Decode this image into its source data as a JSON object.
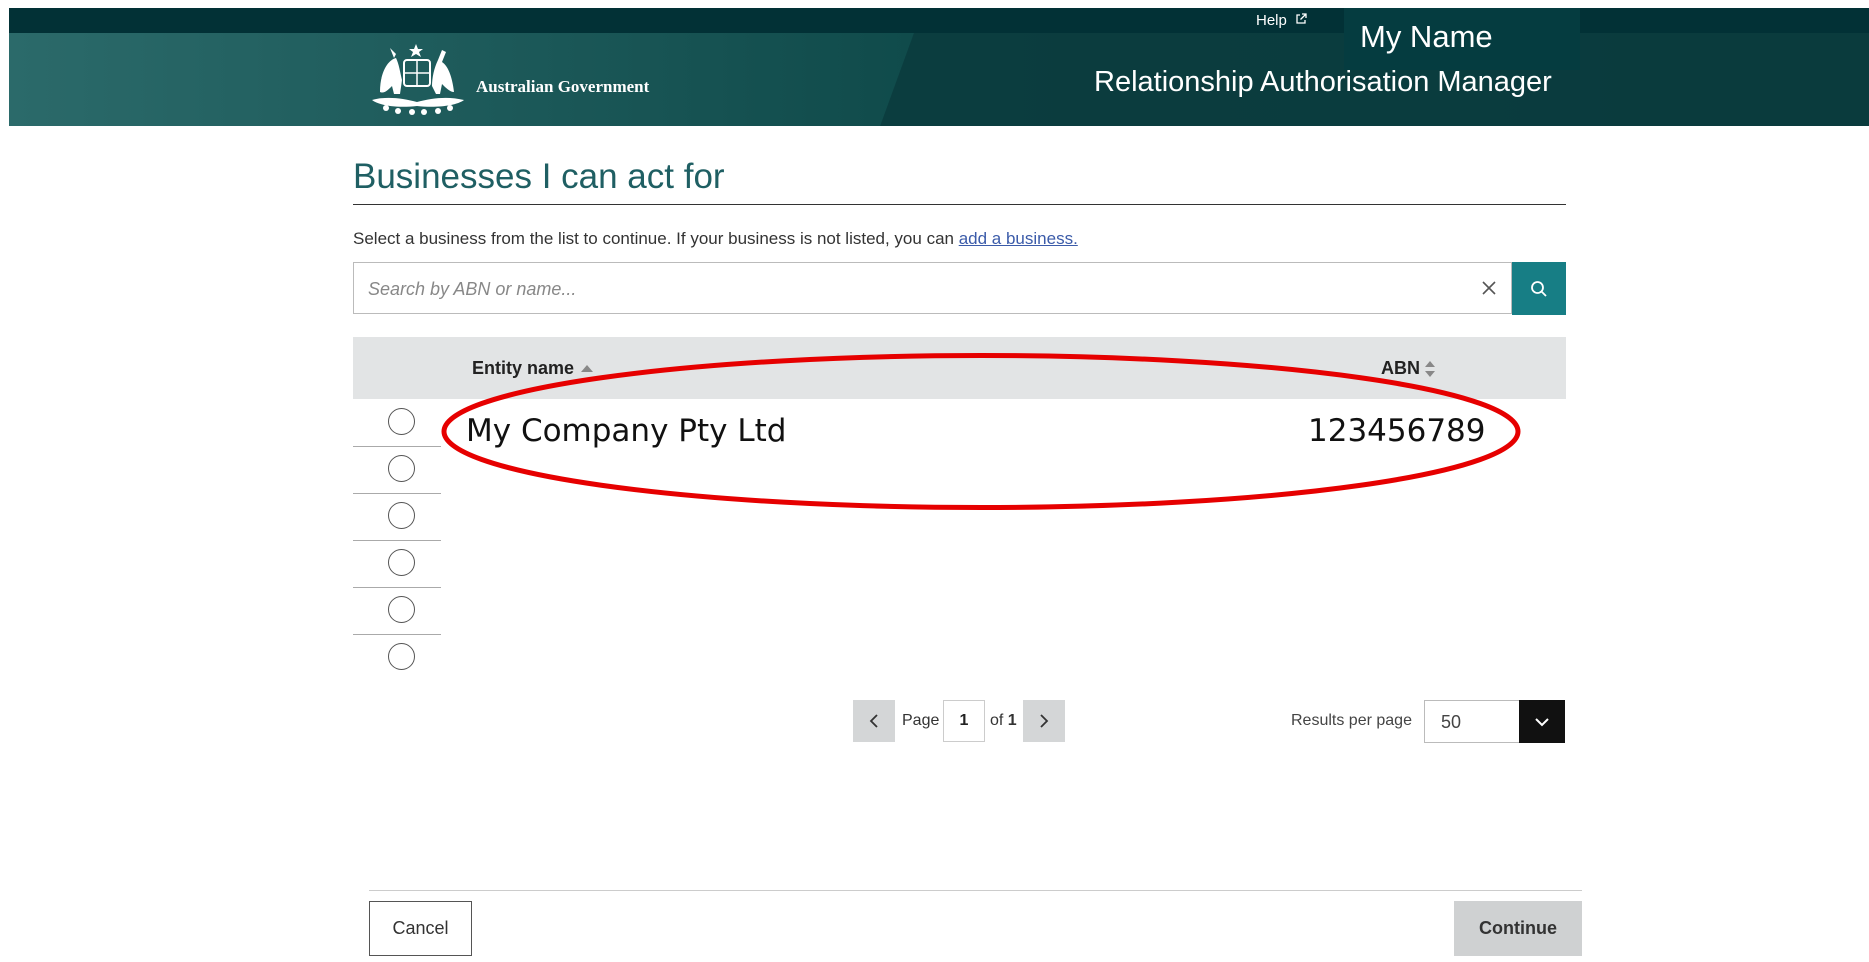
{
  "header": {
    "government_name": "Australian Government",
    "help_label": "Help",
    "user_name": "My Name",
    "app_title": "Relationship Authorisation Manager"
  },
  "page": {
    "title": "Businesses I can act for",
    "intro_text": "Select a business from the list to continue. If your business is not listed, you can ",
    "intro_link": "add a business."
  },
  "search": {
    "placeholder": "Search by ABN or name...",
    "value": ""
  },
  "table": {
    "columns": [
      "Entity name",
      "ABN"
    ],
    "sort": {
      "column": "Entity name",
      "direction": "ascending"
    },
    "rows": [
      {
        "entity_name": "My Company Pty Ltd",
        "abn": "123456789",
        "selected": false
      }
    ],
    "radio_count": 6
  },
  "pagination": {
    "page_label": "Page",
    "current_page": "1",
    "of_label": "of",
    "total_pages": "1"
  },
  "results_per_page": {
    "label": "Results per page",
    "value": "50"
  },
  "footer": {
    "cancel_label": "Cancel",
    "continue_label": "Continue"
  },
  "annotation": {
    "highlight_color": "#e60000"
  },
  "colors": {
    "brand_dark": "#023136",
    "teal": "#177e85",
    "title": "#1f5f63"
  }
}
